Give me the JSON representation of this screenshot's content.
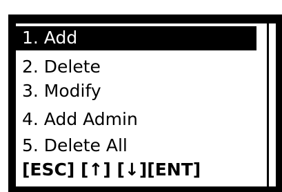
{
  "menu": {
    "items": [
      {
        "label": "1. Add",
        "selected": true
      },
      {
        "label": "2. Delete",
        "selected": false
      },
      {
        "label": "3. Modify",
        "selected": false
      },
      {
        "label": "4. Add Admin",
        "selected": false
      },
      {
        "label": "5. Delete All",
        "selected": false
      }
    ]
  },
  "footer": {
    "hint": "[ESC] [↑] [↓][ENT]"
  },
  "colors": {
    "background": "#ffffff",
    "frame": "#000000",
    "selection": "#000000",
    "selection_text": "#ffffff",
    "text": "#000000"
  }
}
